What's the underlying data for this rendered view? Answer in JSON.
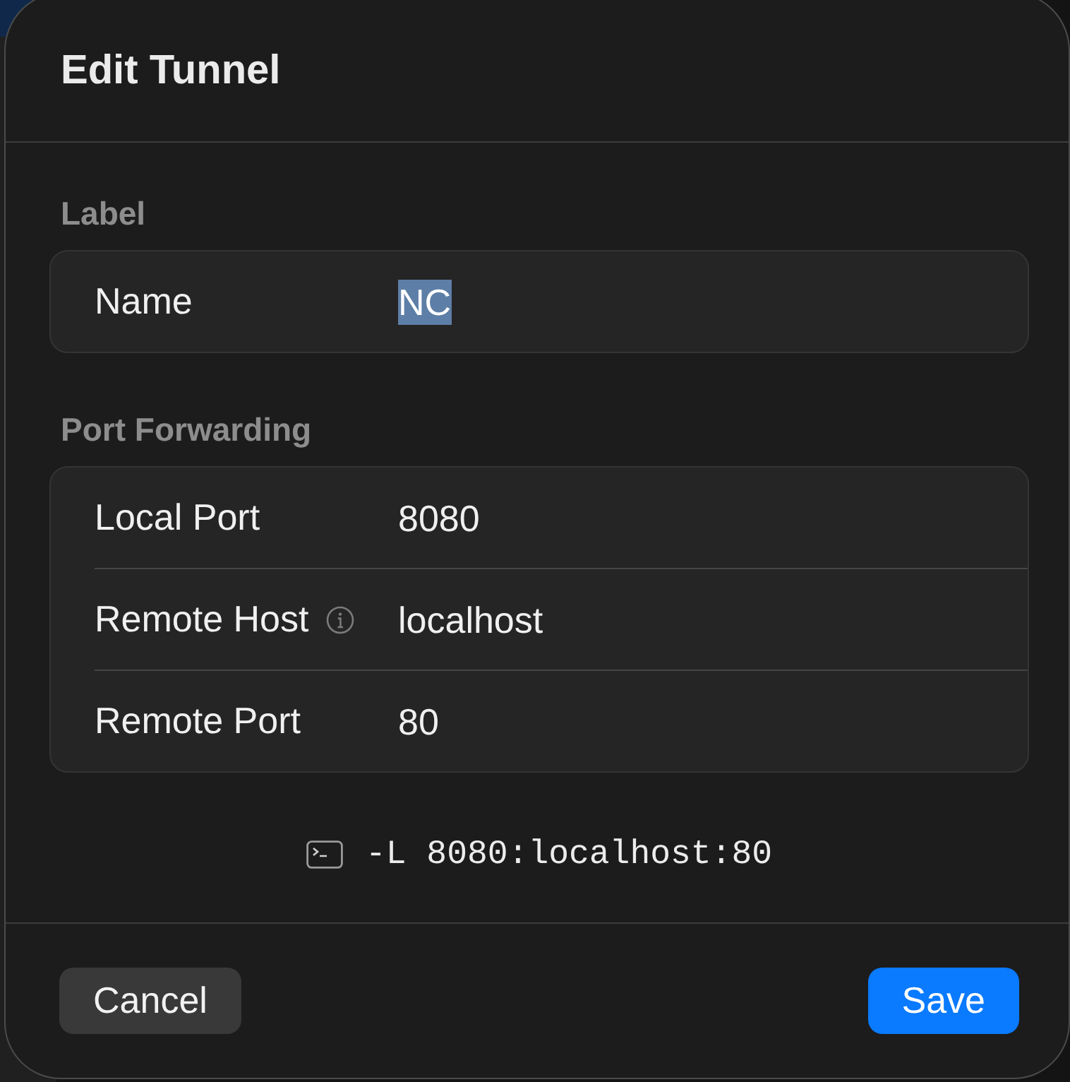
{
  "window": {
    "title": "Edit Tunnel"
  },
  "sections": [
    {
      "header": "Label",
      "rows": [
        {
          "label": "Name",
          "value": "NC",
          "value_selected": true,
          "info": false
        }
      ]
    },
    {
      "header": "Port Forwarding",
      "rows": [
        {
          "label": "Local Port",
          "value": "8080",
          "value_selected": false,
          "info": false
        },
        {
          "label": "Remote Host",
          "value": "localhost",
          "value_selected": false,
          "info": true
        },
        {
          "label": "Remote Port",
          "value": "80",
          "value_selected": false,
          "info": false
        }
      ]
    }
  ],
  "command": {
    "text": "-L 8080:localhost:80"
  },
  "buttons": [
    {
      "label": "Cancel",
      "kind": "secondary"
    },
    {
      "label": "Save",
      "kind": "primary"
    }
  ]
}
